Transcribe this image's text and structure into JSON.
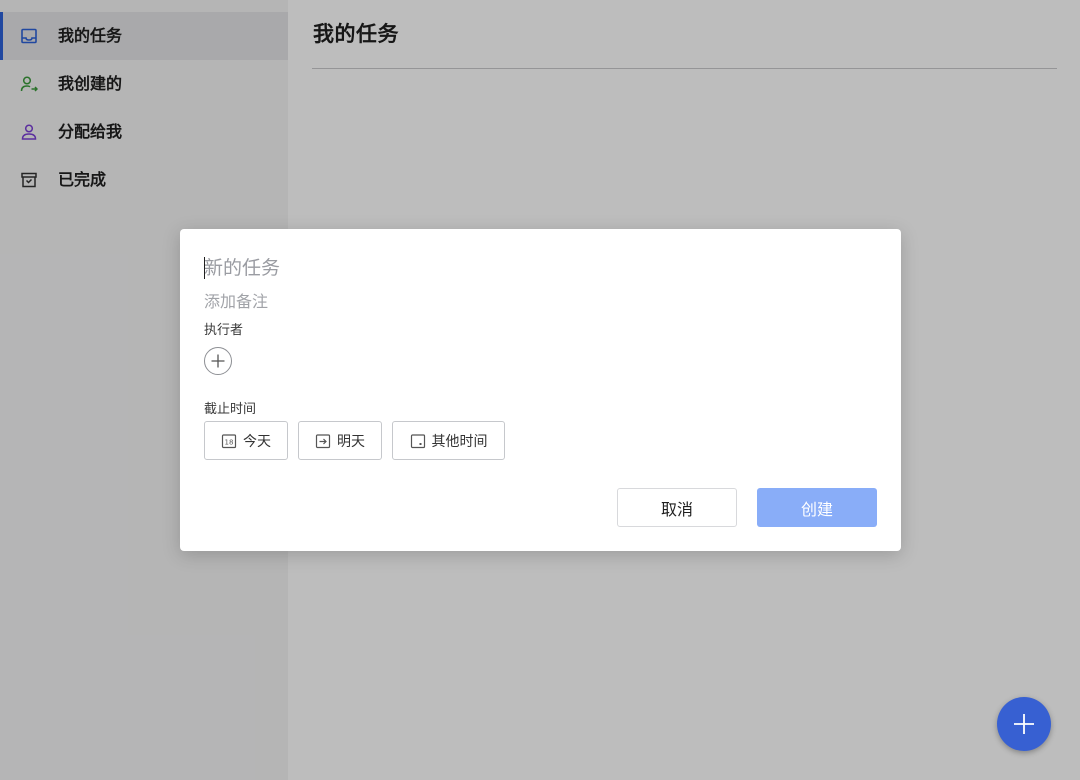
{
  "sidebar": {
    "items": [
      {
        "label": "我的任务",
        "icon": "inbox-icon",
        "color": "#2d62d8",
        "active": true
      },
      {
        "label": "我创建的",
        "icon": "user-arrow-icon",
        "color": "#3a9a3a",
        "active": false
      },
      {
        "label": "分配给我",
        "icon": "user-icon",
        "color": "#7b3fd6",
        "active": false
      },
      {
        "label": "已完成",
        "icon": "archive-box-icon",
        "color": "#333333",
        "active": false
      }
    ]
  },
  "main": {
    "title": "我的任务"
  },
  "dialog": {
    "title_placeholder": "新的任务",
    "title_value": "",
    "note_placeholder": "添加备注",
    "note_value": "",
    "assignee_label": "执行者",
    "deadline_label": "截止时间",
    "date_options": [
      {
        "label": "今天",
        "icon": "calendar-today-icon",
        "icon_text": "18"
      },
      {
        "label": "明天",
        "icon": "calendar-arrow-icon"
      },
      {
        "label": "其他时间",
        "icon": "calendar-blank-icon"
      }
    ],
    "cancel_label": "取消",
    "create_label": "创建"
  },
  "colors": {
    "accent": "#2d62d8",
    "fab": "#3760d2",
    "create_disabled": "#89adf8"
  }
}
